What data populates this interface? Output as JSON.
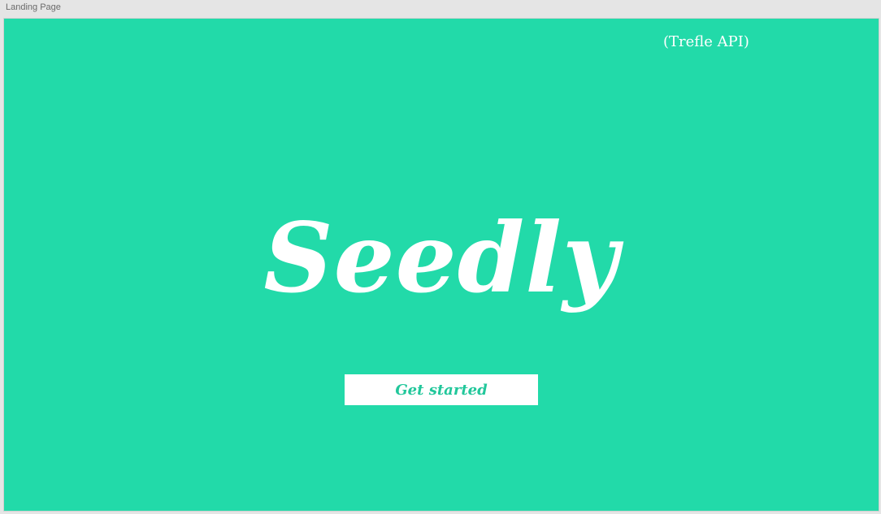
{
  "artboard": {
    "label": "Landing Page"
  },
  "header": {
    "api_tag": "(Trefle API)"
  },
  "hero": {
    "logo": "Seedly",
    "cta_label": "Get started"
  },
  "colors": {
    "background": "#22daa9",
    "accent_text": "#22c79b",
    "foreground": "#ffffff"
  }
}
